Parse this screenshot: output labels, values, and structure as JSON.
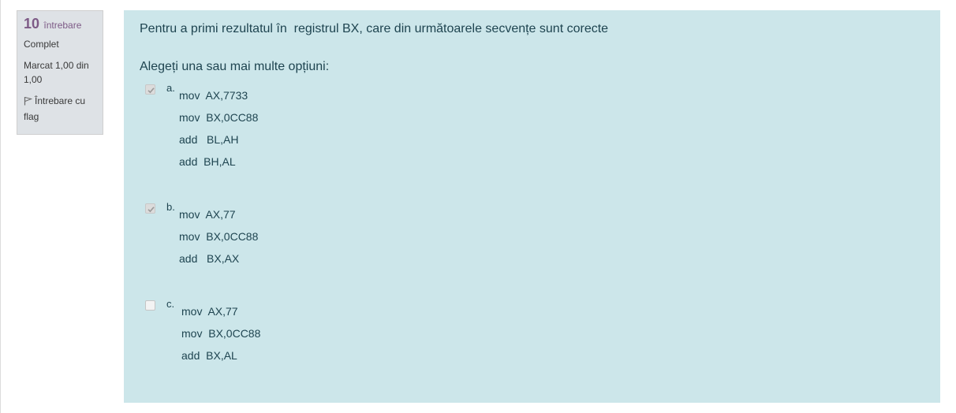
{
  "info": {
    "question_number": "10",
    "question_word": "întrebare",
    "state": "Complet",
    "grade": "Marcat 1,00 din 1,00",
    "flag_label": "Întrebare cu flag"
  },
  "question": {
    "text": "Pentru a primi rezultatul în  registrul BX, care din următoarele secvențe sunt corecte",
    "prompt": "Alegeți una sau mai multe opțiuni:"
  },
  "options": [
    {
      "letter": "a.",
      "checked": true,
      "lines": [
        "mov  AX,7733",
        "mov  BX,0CC88",
        "add   BL,AH",
        "add  BH,AL"
      ]
    },
    {
      "letter": "b.",
      "checked": true,
      "lines": [
        "mov  AX,77",
        "mov  BX,0CC88",
        "add   BX,AX"
      ]
    },
    {
      "letter": "c.",
      "checked": false,
      "lines": [
        "mov  AX,77",
        "mov  BX,0CC88",
        "add  BX,AL"
      ]
    }
  ],
  "colors": {
    "info_bg": "#dee2e6",
    "content_bg": "#cce6ea",
    "question_number": "#7d5a86",
    "text": "#1e4450"
  }
}
